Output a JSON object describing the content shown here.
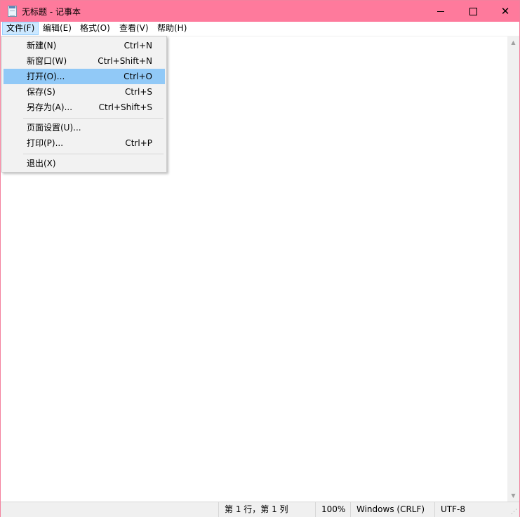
{
  "window": {
    "title": "无标题 - 记事本"
  },
  "menubar": {
    "items": [
      {
        "label": "文件(F)"
      },
      {
        "label": "编辑(E)"
      },
      {
        "label": "格式(O)"
      },
      {
        "label": "查看(V)"
      },
      {
        "label": "帮助(H)"
      }
    ]
  },
  "file_menu": {
    "items": [
      {
        "label": "新建(N)",
        "shortcut": "Ctrl+N"
      },
      {
        "label": "新窗口(W)",
        "shortcut": "Ctrl+Shift+N"
      },
      {
        "label": "打开(O)...",
        "shortcut": "Ctrl+O"
      },
      {
        "label": "保存(S)",
        "shortcut": "Ctrl+S"
      },
      {
        "label": "另存为(A)...",
        "shortcut": "Ctrl+Shift+S"
      },
      {
        "label": "页面设置(U)...",
        "shortcut": ""
      },
      {
        "label": "打印(P)...",
        "shortcut": "Ctrl+P"
      },
      {
        "label": "退出(X)",
        "shortcut": ""
      }
    ],
    "highlighted": "打开(O)..."
  },
  "editor": {
    "text": ""
  },
  "statusbar": {
    "position": "第 1 行，第 1 列",
    "zoom": "100%",
    "line_ending": "Windows (CRLF)",
    "encoding": "UTF-8"
  },
  "colors": {
    "titlebar": "#fe7a9c",
    "menu_highlight": "#91c9f7"
  }
}
